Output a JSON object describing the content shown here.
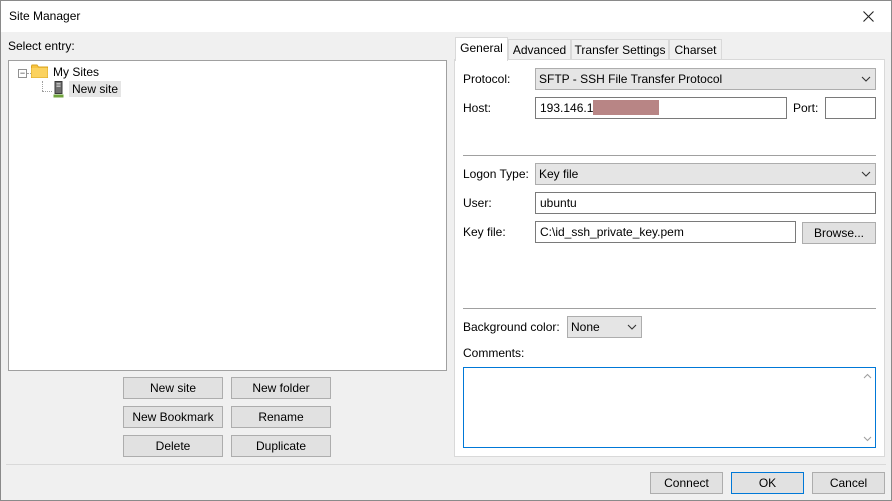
{
  "window": {
    "title": "Site Manager"
  },
  "left": {
    "select_label": "Select entry:",
    "tree": {
      "root": "My Sites",
      "child": "New site"
    },
    "buttons": {
      "new_site": "New site",
      "new_folder": "New folder",
      "new_bookmark": "New Bookmark",
      "rename": "Rename",
      "delete": "Delete",
      "duplicate": "Duplicate"
    }
  },
  "tabs": [
    "General",
    "Advanced",
    "Transfer Settings",
    "Charset"
  ],
  "general": {
    "protocol_label": "Protocol:",
    "protocol_value": "SFTP - SSH File Transfer Protocol",
    "host_label": "Host:",
    "host_value": "193.146.1",
    "port_label": "Port:",
    "port_value": "",
    "logon_type_label": "Logon Type:",
    "logon_type_value": "Key file",
    "user_label": "User:",
    "user_value": "ubuntu",
    "key_file_label": "Key file:",
    "key_file_value": "C:\\id_ssh_private_key.pem",
    "browse_label": "Browse...",
    "bg_color_label": "Background color:",
    "bg_color_value": "None",
    "comments_label": "Comments:",
    "comments_value": ""
  },
  "footer": {
    "connect": "Connect",
    "ok": "OK",
    "cancel": "Cancel"
  },
  "icons": {
    "close": "close-icon",
    "folder": "folder-icon",
    "site": "site-icon",
    "dropdown": "chevron-down-icon"
  },
  "colors": {
    "accent": "#0078d7",
    "folder": "#f8c33f",
    "redaction": "#b88585"
  }
}
